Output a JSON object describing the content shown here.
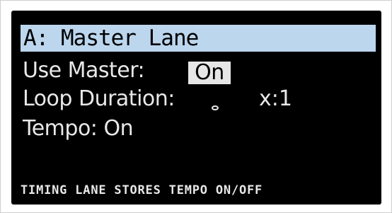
{
  "display": {
    "title": "A: Master Lane",
    "use_master": {
      "label": "Use Master:",
      "value": "On"
    },
    "loop_duration": {
      "label": "Loop Duration:",
      "note_icon": "whole-note-icon",
      "multiplier": "x:1"
    },
    "tempo": {
      "label": "Tempo: On"
    },
    "status": "TIMING LANE STORES TEMPO ON/OFF"
  },
  "colors": {
    "screen_background": "#000000",
    "title_highlight": "#bcd6ee",
    "text": "#e8e8e8",
    "value_highlight": "#e6e6e6"
  }
}
